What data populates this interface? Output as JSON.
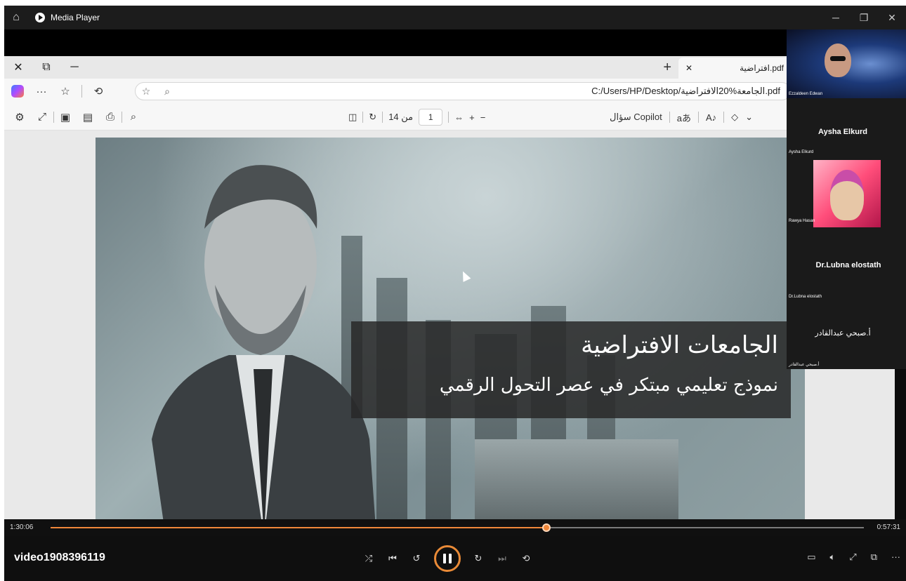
{
  "media_player": {
    "title": "Media Player",
    "video_name": "video1908396119",
    "elapsed": "1:30:06",
    "remaining": "0:57:31",
    "progress": 0.61
  },
  "browser": {
    "tab_title": "افتراضية.pdf",
    "url": "C:/Users/HP/Desktop/الجامعة%20الافتراضية.pdf",
    "page_of": "من 14",
    "page_current": "1",
    "copilot_label": "سؤال Copilot"
  },
  "slide": {
    "title": "الجامعات الافتراضية",
    "subtitle": "نموذج تعليمي مبتكر في عصر التحول الرقمي"
  },
  "participants": [
    {
      "label": "Ezzaldeen Edwan"
    },
    {
      "name": "Aysha Elkurd",
      "label": "Aysha Elkurd"
    },
    {
      "label": "Rawya Hasan"
    },
    {
      "name": "Dr.Lubna elostath",
      "label": "Dr.Lubna elostath"
    },
    {
      "name": "أ.صبحي عبدالقادر",
      "label": "أ.صبحي عبدالقادر"
    }
  ],
  "colors": {
    "accent": "#f0873a",
    "panel": "#1a1a1a"
  }
}
